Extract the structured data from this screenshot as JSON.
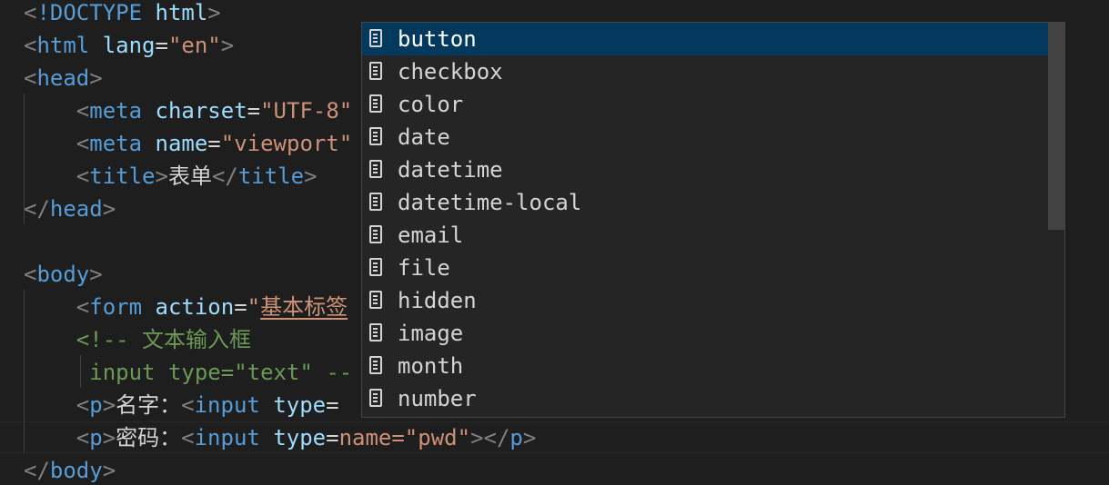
{
  "editor": {
    "lines": [
      [
        {
          "c": "punct",
          "t": "<"
        },
        {
          "c": "tag",
          "t": "!DOCTYPE "
        },
        {
          "c": "attr",
          "t": "html"
        },
        {
          "c": "punct",
          "t": ">"
        }
      ],
      [
        {
          "c": "punct",
          "t": "<"
        },
        {
          "c": "tag",
          "t": "html "
        },
        {
          "c": "attr",
          "t": "lang"
        },
        {
          "c": "text",
          "t": "="
        },
        {
          "c": "str",
          "t": "\"en\""
        },
        {
          "c": "punct",
          "t": ">"
        }
      ],
      [
        {
          "c": "punct",
          "t": "<"
        },
        {
          "c": "tag",
          "t": "head"
        },
        {
          "c": "punct",
          "t": ">"
        }
      ],
      [
        {
          "c": "text",
          "t": "    "
        },
        {
          "c": "punct",
          "t": "<"
        },
        {
          "c": "tag",
          "t": "meta "
        },
        {
          "c": "attr",
          "t": "charset"
        },
        {
          "c": "text",
          "t": "="
        },
        {
          "c": "str",
          "t": "\"UTF-8\""
        }
      ],
      [
        {
          "c": "text",
          "t": "    "
        },
        {
          "c": "punct",
          "t": "<"
        },
        {
          "c": "tag",
          "t": "meta "
        },
        {
          "c": "attr",
          "t": "name"
        },
        {
          "c": "text",
          "t": "="
        },
        {
          "c": "str",
          "t": "\"viewport\""
        }
      ],
      [
        {
          "c": "text",
          "t": "    "
        },
        {
          "c": "punct",
          "t": "<"
        },
        {
          "c": "tag",
          "t": "title"
        },
        {
          "c": "punct",
          "t": ">"
        },
        {
          "c": "text",
          "t": "表单"
        },
        {
          "c": "punct",
          "t": "</"
        },
        {
          "c": "tag",
          "t": "title"
        },
        {
          "c": "punct",
          "t": ">"
        }
      ],
      [
        {
          "c": "punct",
          "t": "</"
        },
        {
          "c": "tag",
          "t": "head"
        },
        {
          "c": "punct",
          "t": ">"
        }
      ],
      [],
      [
        {
          "c": "punct",
          "t": "<"
        },
        {
          "c": "tag",
          "t": "body"
        },
        {
          "c": "punct",
          "t": ">"
        }
      ],
      [
        {
          "c": "text",
          "t": "    "
        },
        {
          "c": "punct",
          "t": "<"
        },
        {
          "c": "tag",
          "t": "form "
        },
        {
          "c": "attr",
          "t": "action"
        },
        {
          "c": "text",
          "t": "="
        },
        {
          "c": "str",
          "t": "\""
        },
        {
          "c": "str",
          "t": "基本标签",
          "u": true
        }
      ],
      [
        {
          "c": "text",
          "t": "    "
        },
        {
          "c": "comment",
          "t": "<!-- 文本输入框"
        }
      ],
      [
        {
          "c": "text",
          "t": "     "
        },
        {
          "c": "comment",
          "t": "input type=\"text\" --"
        }
      ],
      [
        {
          "c": "text",
          "t": "    "
        },
        {
          "c": "punct",
          "t": "<"
        },
        {
          "c": "tag",
          "t": "p"
        },
        {
          "c": "punct",
          "t": ">"
        },
        {
          "c": "text",
          "t": "名字："
        },
        {
          "c": "punct",
          "t": "<"
        },
        {
          "c": "tag",
          "t": "input "
        },
        {
          "c": "attr",
          "t": "type"
        },
        {
          "c": "text",
          "t": "="
        }
      ],
      [
        {
          "c": "text",
          "t": "    "
        },
        {
          "c": "punct",
          "t": "<"
        },
        {
          "c": "tag",
          "t": "p"
        },
        {
          "c": "punct",
          "t": ">"
        },
        {
          "c": "text",
          "t": "密码："
        },
        {
          "c": "punct",
          "t": "<"
        },
        {
          "c": "tag",
          "t": "input "
        },
        {
          "c": "attr",
          "t": "type"
        },
        {
          "c": "text",
          "t": "="
        },
        {
          "c": "str",
          "t": "name=\"pwd\""
        },
        {
          "c": "punct",
          "t": "></"
        },
        {
          "c": "tag",
          "t": "p"
        },
        {
          "c": "punct",
          "t": ">"
        }
      ],
      [
        {
          "c": "punct",
          "t": "</"
        },
        {
          "c": "tag",
          "t": "body"
        },
        {
          "c": "punct",
          "t": ">"
        }
      ]
    ]
  },
  "suggest": {
    "items": [
      {
        "label": "button",
        "icon": "property-icon",
        "selected": true
      },
      {
        "label": "checkbox",
        "icon": "property-icon"
      },
      {
        "label": "color",
        "icon": "property-icon"
      },
      {
        "label": "date",
        "icon": "property-icon"
      },
      {
        "label": "datetime",
        "icon": "property-icon"
      },
      {
        "label": "datetime-local",
        "icon": "property-icon"
      },
      {
        "label": "email",
        "icon": "property-icon"
      },
      {
        "label": "file",
        "icon": "property-icon"
      },
      {
        "label": "hidden",
        "icon": "property-icon"
      },
      {
        "label": "image",
        "icon": "property-icon"
      },
      {
        "label": "month",
        "icon": "property-icon"
      },
      {
        "label": "number",
        "icon": "property-icon"
      }
    ]
  },
  "colors": {
    "background": "#1e1e1e",
    "tag": "#569cd6",
    "attribute": "#9cdcfe",
    "string": "#ce9178",
    "comment": "#6a9955",
    "punctuation": "#808080",
    "selection": "#04395e"
  }
}
